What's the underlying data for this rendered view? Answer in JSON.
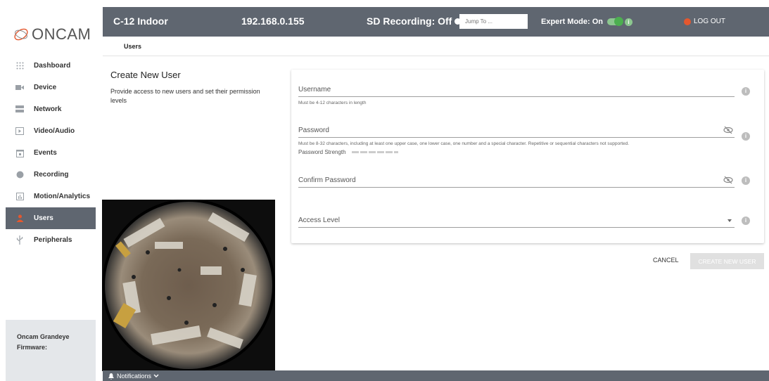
{
  "brand": {
    "logo_text": "ONCAM"
  },
  "header": {
    "camera_name": "C-12 Indoor",
    "ip": "192.168.0.155",
    "sd_recording": "SD Recording: Off",
    "jump_placeholder": "Jump To ...",
    "expert_mode": "Expert Mode: On",
    "logout": "LOG OUT"
  },
  "breadcrumb": {
    "current": "Users"
  },
  "sidebar": {
    "items": [
      {
        "label": "Dashboard",
        "icon": "grid-icon"
      },
      {
        "label": "Device",
        "icon": "camera-icon"
      },
      {
        "label": "Network",
        "icon": "network-icon"
      },
      {
        "label": "Video/Audio",
        "icon": "play-icon"
      },
      {
        "label": "Events",
        "icon": "calendar-icon"
      },
      {
        "label": "Recording",
        "icon": "record-icon"
      },
      {
        "label": "Motion/Analytics",
        "icon": "analytics-icon"
      },
      {
        "label": "Users",
        "icon": "user-icon",
        "active": true
      },
      {
        "label": "Peripherals",
        "icon": "usb-icon"
      }
    ],
    "device_name": "Oncam Grandeye",
    "firmware_label": "Firmware: "
  },
  "form": {
    "title": "Create New User",
    "description": "Provide access to new users and set their permission levels",
    "username_label": "Username",
    "username_hint": "Must be 4-12 characters in length",
    "password_label": "Password",
    "password_hint": "Must be 8-32 characters, including at least one upper case, one lower case, one number and a special character. Repetitive or sequential characters not supported.",
    "password_strength_label": "Password Strength",
    "confirm_label": "Confirm Password",
    "access_label": "Access Level",
    "cancel": "CANCEL",
    "create": "CREATE NEW USER"
  },
  "notifications": {
    "label": "Notifications"
  },
  "colors": {
    "header_bg": "#5f6670",
    "accent": "#e4572e",
    "toggle_on": "#4caf50"
  }
}
